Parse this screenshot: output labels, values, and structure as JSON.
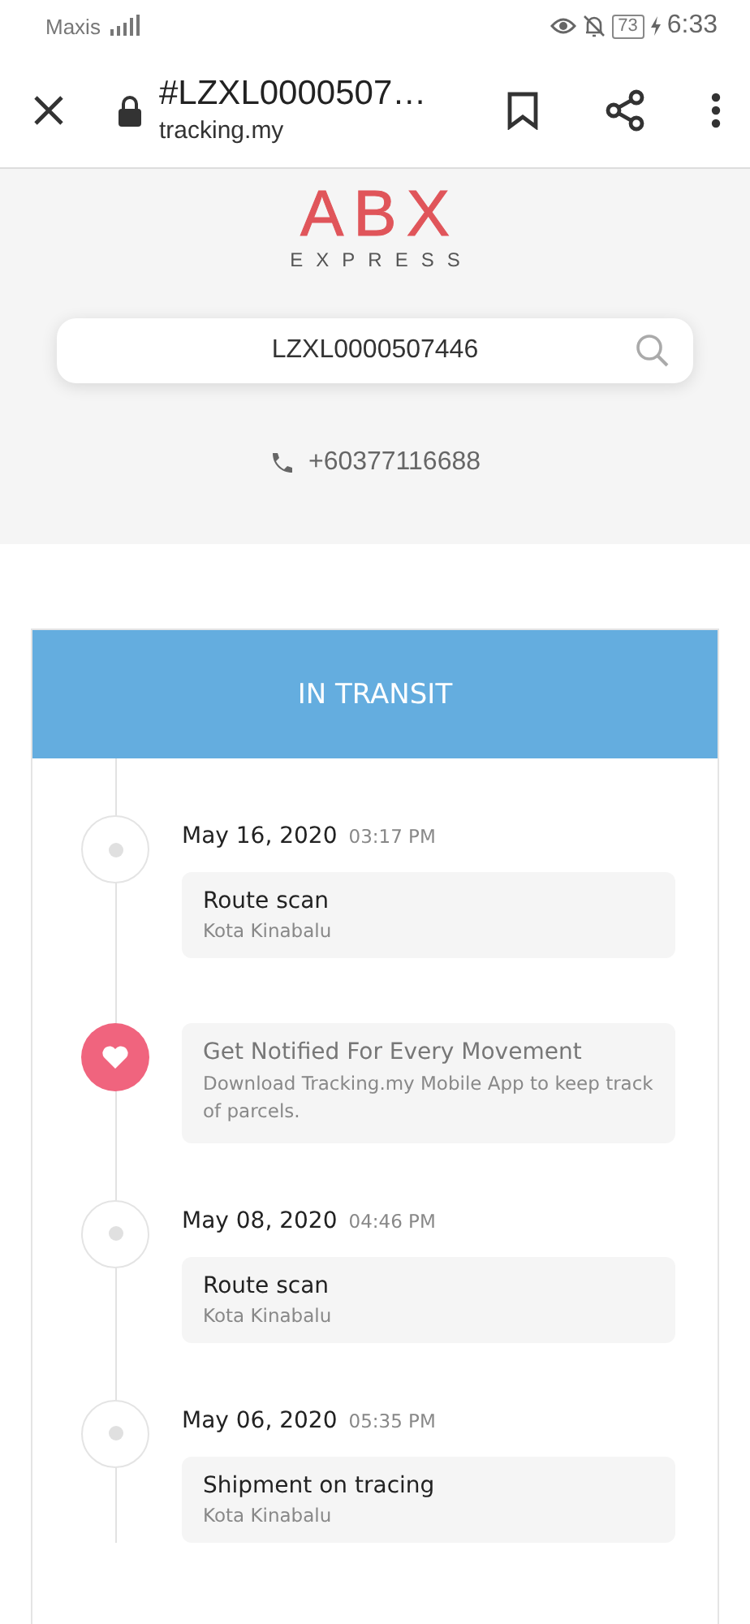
{
  "status_bar": {
    "carrier": "Maxis",
    "battery": "73",
    "time": "6:33"
  },
  "browser": {
    "title": "#LZXL0000507…",
    "url": "tracking.my"
  },
  "header": {
    "logo": {
      "main": "ABX",
      "sub": "EXPRESS"
    },
    "search": {
      "value": "LZXL0000507446"
    },
    "phone": "+60377116688"
  },
  "status": "IN TRANSIT",
  "timeline": [
    {
      "kind": "event",
      "date": "May 16, 2020",
      "time": "03:17 PM",
      "title": "Route scan",
      "location": "Kota Kinabalu"
    },
    {
      "kind": "promo",
      "title": "Get Notified For Every Movement",
      "text": "Download Tracking.my Mobile App to keep track of parcels."
    },
    {
      "kind": "event",
      "date": "May 08, 2020",
      "time": "04:46 PM",
      "title": "Route scan",
      "location": "Kota Kinabalu"
    },
    {
      "kind": "event",
      "date": "May 06, 2020",
      "time": "05:35 PM",
      "title": "Shipment on tracing",
      "location": "Kota Kinabalu"
    }
  ]
}
